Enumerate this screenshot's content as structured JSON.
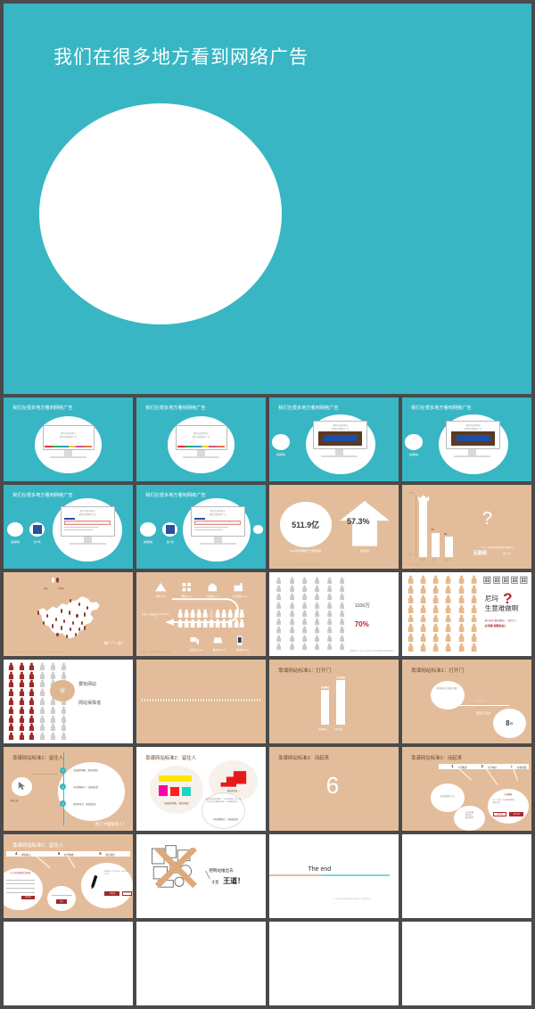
{
  "hero": {
    "title": "我们在很多地方看到网络广告",
    "bg_color": "#38b6c4",
    "shape": "white-ellipse"
  },
  "theme": {
    "teal": "#38b6c4",
    "tan": "#e3bd9b",
    "frame": "#4a4a4a",
    "red": "#b3262a",
    "brown_text": "#6b4a33"
  },
  "grid": {
    "columns": 4,
    "rows": 7,
    "total_slides": 28
  },
  "slides": [
    {
      "n": 1,
      "bg": "teal",
      "title": "我们在很多地方看到网络广告",
      "kind": "monitor-site",
      "screen_text": [
        "我们在很多地方",
        "看到互联网的广告"
      ],
      "icons": []
    },
    {
      "n": 2,
      "bg": "teal",
      "title": "我们在很多地方看到网络广告",
      "kind": "monitor-site",
      "screen_text": [
        "我们在很多地方",
        "看到互联网的广告"
      ],
      "icons": []
    },
    {
      "n": 3,
      "bg": "teal",
      "title": "我们在很多地方看到网络广告",
      "kind": "monitor-video",
      "screen_text": [
        "我们在很多地方",
        "看到互联网的广告"
      ],
      "icons": [
        "视频网站"
      ]
    },
    {
      "n": 4,
      "bg": "teal",
      "title": "我们在很多地方看到网络广告",
      "kind": "monitor-video",
      "screen_text": [
        "我们在很多地方",
        "看到互联网的广告"
      ],
      "icons": [
        "视频网站"
      ]
    },
    {
      "n": 5,
      "bg": "teal",
      "title": "我们在很多地方看到网络广告",
      "kind": "monitor-search",
      "screen_text": [
        "我们在很多地方",
        "看到互联网的广告"
      ],
      "icons": [
        "视频网站",
        "客户端"
      ]
    },
    {
      "n": 6,
      "bg": "teal",
      "title": "我们在很多地方看到网络广告",
      "kind": "monitor-search",
      "screen_text": [
        "我们在很多地方",
        "看到互联网的广告"
      ],
      "icons": [
        "视频网站",
        "客户端"
      ]
    },
    {
      "n": 7,
      "bg": "tan",
      "title": "",
      "kind": "stat-big",
      "stat_value": "511.9亿",
      "stat_caption": "2014年中国网络广告市场规模",
      "growth_value": "57.3%",
      "growth_caption": "同比增长",
      "footnote": "数据来源：艾瑞咨询《2014年中国网络广告市场年度监测报告》"
    },
    {
      "n": 8,
      "bg": "tan",
      "title": "",
      "kind": "bar-chart",
      "bars": [
        {
          "label": "互联网",
          "value": 100
        },
        {
          "label": "电视",
          "value": 34
        },
        {
          "label": "报纸",
          "value": 21
        }
      ],
      "axis_top": "100%",
      "axis_bottom": "0%",
      "highlight": "互联网",
      "highlight_suffix": "的广告！",
      "highlight_lead": "90%以上的中国企业都投放互联网广告",
      "qmark": "?",
      "footnote": "数据来源：艾瑞咨询 2014年中国网络广告"
    },
    {
      "n": 9,
      "bg": "tan",
      "title": "",
      "kind": "china-map",
      "legend": [
        "网民",
        "非网民"
      ],
      "slogan": "哪广广一类！",
      "footnote": "数据来源：中国互联网络信息中心（CNNIC）第35次《中国互联网络发展状况统计报告》"
    },
    {
      "n": 10,
      "bg": "tan",
      "title": "",
      "kind": "channels",
      "top_icons": [
        "新闻 xx.xx",
        "网络 xx.xx",
        "社交网 xx.xx",
        "公共网络 xx.xx"
      ],
      "bottom_icons": [
        "台式机 xx.xx",
        "笔记本 xx.xx",
        "移动端 xx.xx"
      ],
      "center_label": "网络，就是最大的\nXXXXX人气",
      "footnote": "数据来源：中国互联网络信息中心（CNNIC）"
    },
    {
      "n": 11,
      "bg": "white",
      "title": "",
      "kind": "people-stat",
      "stat_num": "1100万",
      "stat_pct": "70%",
      "footnote": "数据来源：CNNIC《中国中小企业互联网应用调研报告》"
    },
    {
      "n": 12,
      "bg": "white",
      "title": "",
      "kind": "people-question",
      "headline_1": "尼玛",
      "headline_2": "生意难做啊",
      "sub_1": "那么多同行都在做网站——我也之下，",
      "sub_2": "必须要 脱颖而出！",
      "qmark": "?"
    },
    {
      "n": 13,
      "bg": "white",
      "title": "",
      "kind": "people-badge",
      "badge": "促进\n销售",
      "line_1": "要有网站",
      "line_2": "网站得靠谱"
    },
    {
      "n": 14,
      "bg": "tan",
      "title": "",
      "kind": "dotted-divider"
    },
    {
      "n": 15,
      "bg": "tan",
      "title": "靠谱网站标准1：打开门",
      "kind": "two-bars",
      "bars": [
        {
          "label": "其他网站",
          "value": 60
        },
        {
          "label": "打开速度",
          "value": 100
        }
      ]
    },
    {
      "n": 16,
      "bg": "tan",
      "title": "靠谱网站标准1：打开门",
      "kind": "speed-callout",
      "bubble": "你的网站打开速度太慢了",
      "caption": "极限打开速度",
      "big_value": "8",
      "big_unit": "秒"
    },
    {
      "n": 17,
      "bg": "tan",
      "title": "靠谱网站标准2：留住人",
      "kind": "timeline",
      "left_label": "访客上屏",
      "steps": [
        {
          "n": "1",
          "text": "页面结构清晰、界面美观度"
        },
        {
          "n": "2",
          "text": "导航清晰明了、功能易找到"
        },
        {
          "n": "3",
          "text": "视觉有吸引、体验度舒适"
        }
      ],
      "slogan": "改了才能留住人！"
    },
    {
      "n": 18,
      "bg": "white",
      "title": "靠谱网站标准2：留住人",
      "kind": "color-blocks",
      "caption_left": "页面结构清晰、界面美观度",
      "caption_right": "网站配色统一",
      "bubble": "网站的整体配色要统一，主色调不超过三种，辅助色与主色调搭配协调，让访客感觉舒适。",
      "caption_bottom": "导航清晰明了、功能易找到"
    },
    {
      "n": 19,
      "bg": "tan",
      "title": "靠谱网站标准3：动起来",
      "kind": "big-number",
      "number": "6"
    },
    {
      "n": 20,
      "bg": "tan",
      "title": "靠谱网站标准3：动起来",
      "kind": "ribbon-steps",
      "steps": [
        {
          "n": "1",
          "text": "公司概述"
        },
        {
          "n": "2",
          "text": "公司地址"
        },
        {
          "n": "3",
          "text": "在线客服"
        }
      ],
      "note_a": "咨询的联系方式",
      "note_b": "公司开通\n四百电二\n商业用号",
      "bubble_title": "在线客服",
      "bubble_text": "每一个页面，在线客服都要在\n明显位置！",
      "bubble_btn_1": "在线咨询",
      "bubble_btn_2": "拨打电话"
    },
    {
      "n": 21,
      "bg": "tan",
      "title": "靠谱网站标准3：留住人",
      "kind": "ribbon-steps-2",
      "steps": [
        {
          "n": "4",
          "text": "网站留言"
        },
        {
          "n": "5",
          "text": "在线购物"
        },
        {
          "n": "6",
          "text": "微店微信"
        }
      ],
      "form_title": "XX公司在线留言咨询表",
      "form_btn": "提交留言",
      "mid_btn": "提交",
      "card_btn_1": "立即购买",
      "card_btn_2": "加入购物车"
    },
    {
      "n": 22,
      "bg": "white",
      "title": "",
      "kind": "push-out",
      "line_1": "把网站推出去",
      "line_2_a": "才是",
      "line_2_b": "王道！"
    },
    {
      "n": 23,
      "bg": "white",
      "title": "",
      "kind": "the-end",
      "end_text": "The end",
      "footnote": "以上为部分内容版权归原作者所有，仅供参考学习"
    },
    {
      "n": 24,
      "bg": "blank",
      "title": "",
      "kind": "blank"
    },
    {
      "n": 25,
      "bg": "blank",
      "title": "",
      "kind": "blank"
    },
    {
      "n": 26,
      "bg": "blank",
      "title": "",
      "kind": "blank"
    },
    {
      "n": 27,
      "bg": "blank",
      "title": "",
      "kind": "blank"
    },
    {
      "n": 28,
      "bg": "blank",
      "title": "",
      "kind": "blank"
    }
  ]
}
